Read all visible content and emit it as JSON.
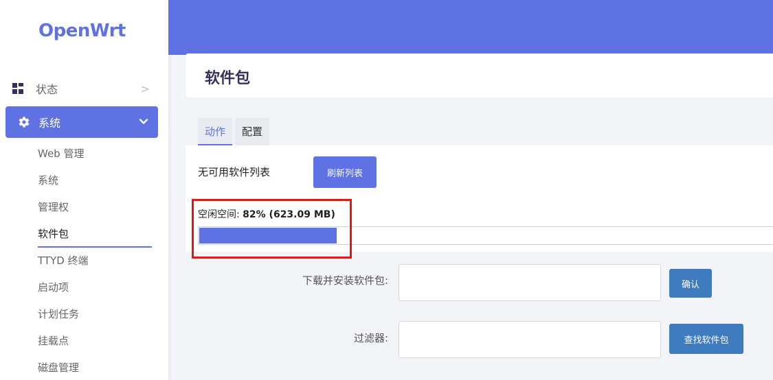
{
  "app": {
    "logo": "OpenWrt"
  },
  "sidebar": {
    "status": {
      "label": "状态",
      "chevron": ">"
    },
    "system": {
      "label": "系统"
    },
    "submenu": [
      {
        "label": "Web 管理"
      },
      {
        "label": "系统"
      },
      {
        "label": "管理权"
      },
      {
        "label": "软件包"
      },
      {
        "label": "TTYD 终端"
      },
      {
        "label": "启动项"
      },
      {
        "label": "计划任务"
      },
      {
        "label": "挂载点"
      },
      {
        "label": "磁盘管理"
      }
    ],
    "current_index": 3
  },
  "page": {
    "title": "软件包",
    "tabs": [
      {
        "label": "动作"
      },
      {
        "label": "配置"
      }
    ]
  },
  "actions": {
    "no_list_text": "无可用软件列表",
    "refresh_label": "刷新列表",
    "free_space_label": "空闲空间:",
    "free_space_value": "82% (623.09 MB)",
    "free_space_fraction": 0.24
  },
  "form": {
    "download_label": "下载并安装软件包:",
    "download_value": "",
    "confirm_label": "确认",
    "filter_label": "过滤器:",
    "filter_value": "",
    "search_label": "查找软件包"
  },
  "colors": {
    "accent": "#5e72e4",
    "button_blue": "#3e7bbf",
    "highlight": "#ee1111"
  }
}
